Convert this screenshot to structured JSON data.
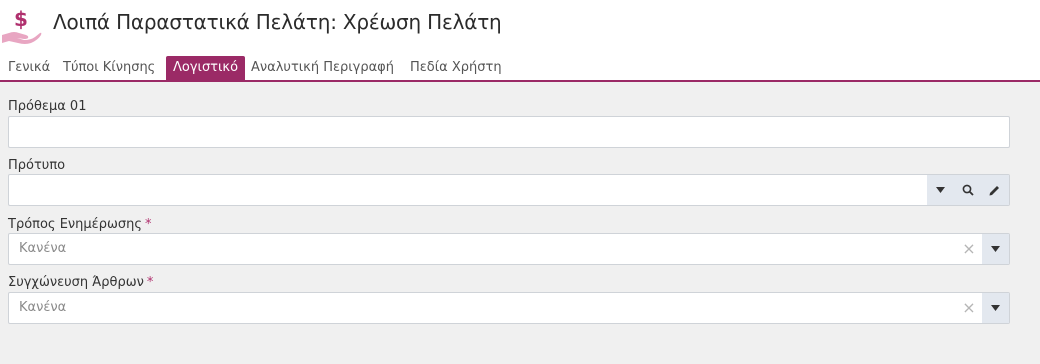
{
  "header": {
    "title": "Λοιπά Παραστατικά Πελάτη: Χρέωση Πελάτη",
    "logo_icon": "money-hand-icon",
    "logo_colors": {
      "dollar": "#b0306e",
      "hand": "#e8a6c2"
    }
  },
  "tabs": [
    {
      "label": "Γενικά",
      "active": false
    },
    {
      "label": "Τύποι Κίνησης",
      "active": false
    },
    {
      "label": "Λογιστικό",
      "active": true
    },
    {
      "label": "Αναλυτική Περιγραφή",
      "active": false
    },
    {
      "label": "Πεδία Χρήστη",
      "active": false
    }
  ],
  "accent_color": "#9b2a66",
  "form": {
    "prefix": {
      "label": "Πρόθεμα 01",
      "value": ""
    },
    "template": {
      "label": "Πρότυπο",
      "value": "",
      "icons": [
        "dropdown-icon",
        "search-icon",
        "edit-icon"
      ]
    },
    "update_mode": {
      "label": "Τρόπος Ενημέρωσης",
      "required_mark": "*",
      "value": "Κανένα",
      "clear_glyph": "×"
    },
    "merge_lines": {
      "label": "Συγχώνευση Άρθρων",
      "required_mark": "*",
      "value": "Κανένα",
      "clear_glyph": "×"
    }
  }
}
